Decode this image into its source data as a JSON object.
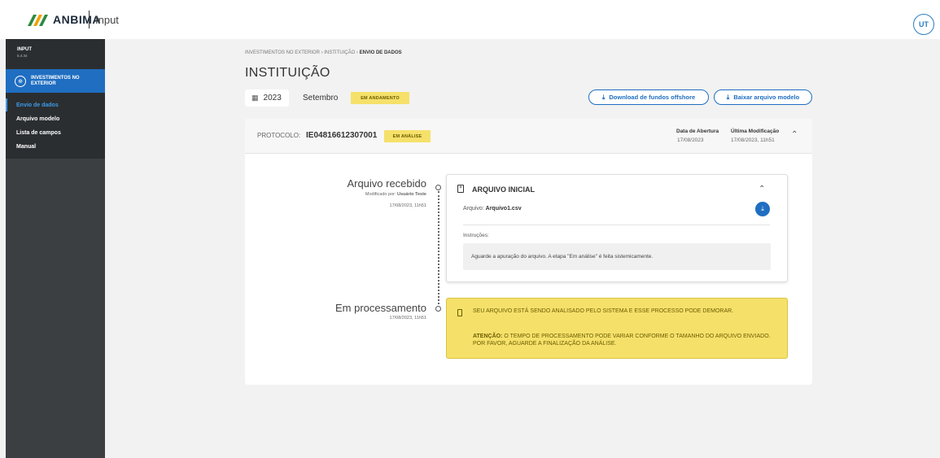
{
  "header": {
    "logo_text": "ANBIMA",
    "app_name": "Input",
    "avatar_initials": "UT"
  },
  "sidebar": {
    "app": "INPUT",
    "version": "5.4.34",
    "section": "INVESTIMENTOS NO EXTERIOR",
    "items": [
      {
        "label": "Envio de dados",
        "active": true
      },
      {
        "label": "Arquivo modelo",
        "active": false
      },
      {
        "label": "Lista de campos",
        "active": false
      },
      {
        "label": "Manual",
        "active": false
      }
    ]
  },
  "main": {
    "breadcrumb": [
      "INVESTIMENTOS NO EXTERIOR",
      "INSTITUIÇÃO",
      "ENVIO DE DADOS"
    ],
    "title": "INSTITUIÇÃO",
    "year": "2023",
    "month": "Setembro",
    "period_status": "EM ANDAMENTO",
    "download_offshore_label": "Download de fundos offshore",
    "download_model_label": "Baixar arquivo modelo"
  },
  "protocol": {
    "label": "PROTOCOLO:",
    "value": "IE04816612307001",
    "status": "EM ANÁLISE",
    "opened_label": "Data de Abertura",
    "opened_value": "17/08/2023",
    "modified_label": "Última Modificação",
    "modified_value": "17/08/2023, 11h51"
  },
  "timeline": {
    "step1": {
      "title": "Arquivo recebido",
      "modified_by_prefix": "Modificado por:",
      "modified_by": "Usuário Teste",
      "timestamp": "17/08/2023, 11h51"
    },
    "step2": {
      "title": "Em processamento",
      "timestamp": "17/08/2023, 11h51"
    }
  },
  "file_panel": {
    "title": "ARQUIVO INICIAL",
    "file_label": "Arquivo:",
    "file_name": "Arquivo1.csv",
    "instructions_label": "Instruções:",
    "instructions_text": "Aguarde a apuração do arquivo. A etapa \"Em análise\" é feita sistemicamente."
  },
  "warning": {
    "line1": "SEU ARQUIVO ESTÁ SENDO ANALISADO PELO SISTEMA E ESSE PROCESSO PODE DEMORAR.",
    "attention_label": "ATENÇÃO:",
    "line2": "O TEMPO DE PROCESSAMENTO PODE VARIAR CONFORME O TAMANHO DO ARQUIVO ENVIADO. POR FAVOR, AGUARDE A FINALIZAÇÃO DA ANÁLISE."
  },
  "colors": {
    "brand_blue": "#1f6ec1",
    "active_link": "#3d9be9",
    "warning_yellow": "#f5e16a",
    "sidebar_dark": "#3b3f42"
  }
}
